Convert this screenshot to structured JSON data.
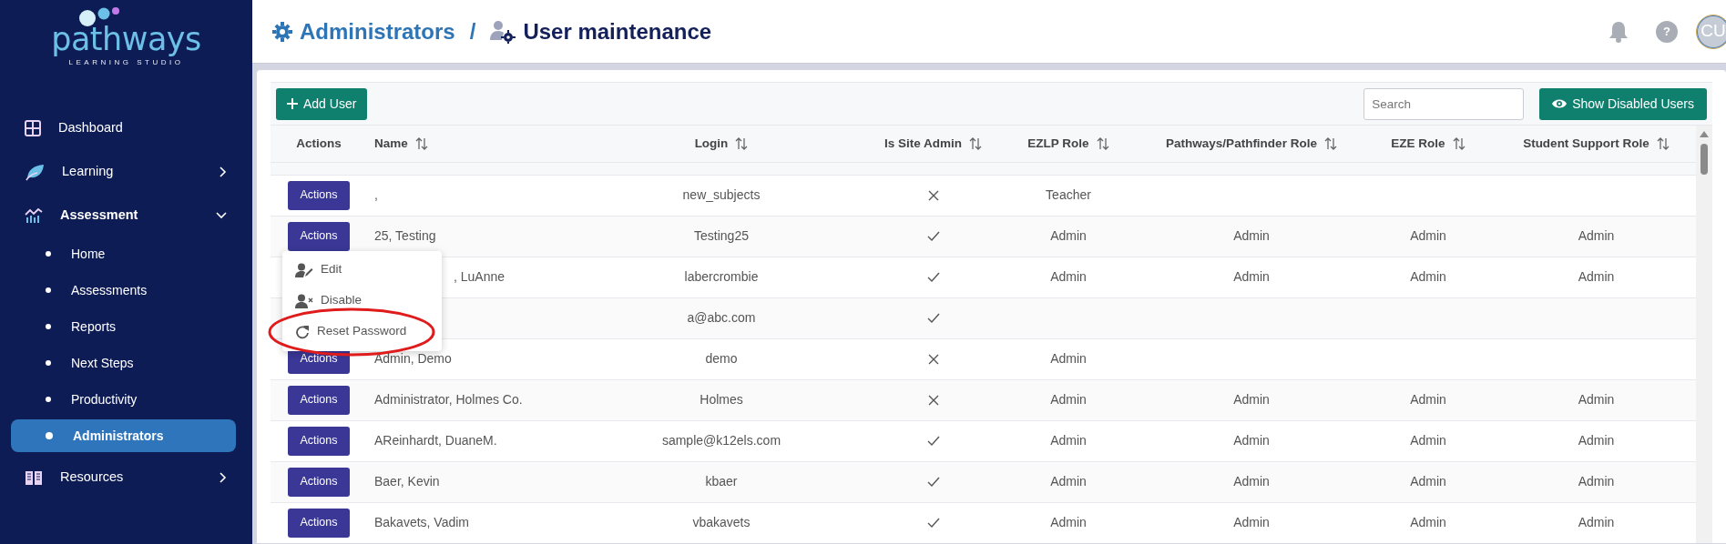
{
  "sidebar": {
    "logo": {
      "name": "pathways",
      "tagline": "LEARNING STUDIO"
    },
    "items": [
      {
        "label": "Dashboard"
      },
      {
        "label": "Learning",
        "expanded": false
      },
      {
        "label": "Assessment",
        "expanded": true,
        "children": [
          {
            "label": "Home",
            "selected": false
          },
          {
            "label": "Assessments",
            "selected": false
          },
          {
            "label": "Reports",
            "selected": false
          },
          {
            "label": "Next Steps",
            "selected": false
          },
          {
            "label": "Productivity",
            "selected": false
          },
          {
            "label": "Administrators",
            "selected": true
          }
        ]
      },
      {
        "label": "Resources",
        "expanded": false
      }
    ]
  },
  "header": {
    "breadcrumb": [
      {
        "label": "Administrators"
      },
      {
        "label": "User maintenance"
      }
    ],
    "separator": "/",
    "help": "?",
    "avatar": "CU"
  },
  "toolbar": {
    "add_button": "Add User",
    "search": {
      "placeholder": "Search"
    },
    "show_disabled_button": "Show Disabled Users"
  },
  "table": {
    "columns": [
      {
        "label": "Actions",
        "sortable": false
      },
      {
        "label": "Name",
        "sortable": true
      },
      {
        "label": "Login",
        "sortable": true
      },
      {
        "label": "Is Site Admin",
        "sortable": true
      },
      {
        "label": "EZLP Role",
        "sortable": true
      },
      {
        "label": "Pathways/Pathfinder Role",
        "sortable": true
      },
      {
        "label": "EZE Role",
        "sortable": true
      },
      {
        "label": "Student Support Role",
        "sortable": true
      }
    ],
    "rows": [
      {
        "action": "Actions",
        "name": ",",
        "login": "new_subjects",
        "site_admin": false,
        "ezlp": "Teacher"
      },
      {
        "action": "Actions",
        "name": "25, Testing",
        "login": "Testing25",
        "site_admin": true,
        "ezlp": "Admin",
        "pathways": "Admin",
        "eze": "Admin",
        "student_support": "Admin",
        "menu": {
          "items": [
            {
              "label": "Edit",
              "circled": false
            },
            {
              "label": "Disable",
              "circled": false
            },
            {
              "label": "Reset Password",
              "circled": true
            }
          ]
        }
      },
      {
        "name": ", LuAnne",
        "name_cut": true,
        "login": "labercrombie",
        "site_admin": true,
        "ezlp": "Admin",
        "pathways": "Admin",
        "eze": "Admin",
        "student_support": "Admin"
      },
      {
        "login": "a@abc.com",
        "site_admin": true
      },
      {
        "action": "Actions",
        "name": "Admin, Demo",
        "login": "demo",
        "site_admin": false,
        "ezlp": "Admin"
      },
      {
        "action": "Actions",
        "name": "Administrator, Holmes Co.",
        "login": "Holmes",
        "site_admin": false,
        "ezlp": "Admin",
        "pathways": "Admin",
        "eze": "Admin",
        "student_support": "Admin"
      },
      {
        "action": "Actions",
        "name": "AReinhardt, DuaneM.",
        "login": "sample@k12els.com",
        "site_admin": true,
        "ezlp": "Admin",
        "pathways": "Admin",
        "eze": "Admin",
        "student_support": "Admin"
      },
      {
        "action": "Actions",
        "name": "Baer, Kevin",
        "login": "kbaer",
        "site_admin": true,
        "ezlp": "Admin",
        "pathways": "Admin",
        "eze": "Admin",
        "student_support": "Admin"
      },
      {
        "action": "Actions",
        "name": "Bakavets, Vadim",
        "login": "vbakavets",
        "site_admin": true,
        "ezlp": "Admin",
        "pathways": "Admin",
        "eze": "Admin",
        "student_support": "Admin"
      }
    ]
  }
}
